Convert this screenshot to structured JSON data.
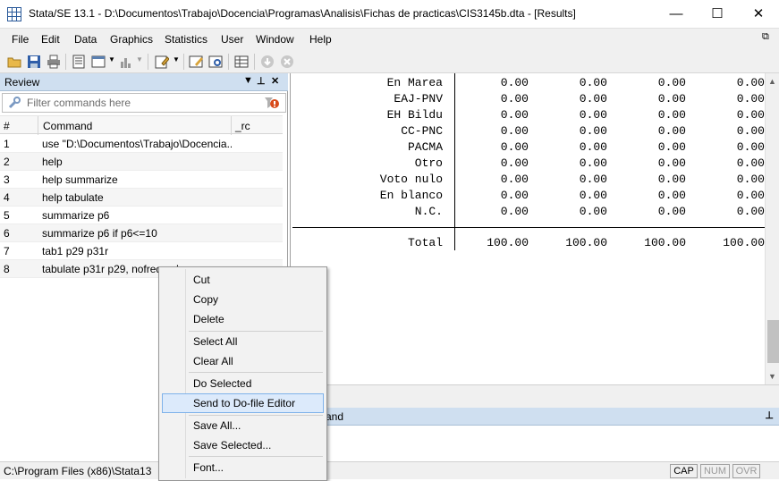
{
  "window": {
    "title": "Stata/SE 13.1 - D:\\Documentos\\Trabajo\\Docencia\\Programas\\Analisis\\Fichas de practicas\\CIS3145b.dta - [Results]",
    "minimize": "—",
    "maximize": "☐",
    "close": "✕"
  },
  "menu": [
    "File",
    "Edit",
    "Data",
    "Graphics",
    "Statistics",
    "User",
    "Window",
    "Help"
  ],
  "review": {
    "title": "Review",
    "filter_placeholder": "Filter commands here",
    "columns": {
      "num": "#",
      "command": "Command",
      "rc": "_rc"
    },
    "rows": [
      {
        "n": "1",
        "cmd": "use \"D:\\Documentos\\Trabajo\\Docencia..."
      },
      {
        "n": "2",
        "cmd": "help"
      },
      {
        "n": "3",
        "cmd": "help summarize"
      },
      {
        "n": "4",
        "cmd": "help tabulate"
      },
      {
        "n": "5",
        "cmd": "summarize p6"
      },
      {
        "n": "6",
        "cmd": "summarize p6 if p6<=10"
      },
      {
        "n": "7",
        "cmd": "tab1 p29 p31r"
      },
      {
        "n": "8",
        "cmd": "tabulate p31r p29, nofreq col"
      }
    ]
  },
  "results": {
    "rows": [
      {
        "label": "En Marea",
        "v": [
          "0.00",
          "0.00",
          "0.00",
          "0.00"
        ]
      },
      {
        "label": "EAJ-PNV",
        "v": [
          "0.00",
          "0.00",
          "0.00",
          "0.00"
        ]
      },
      {
        "label": "EH Bildu",
        "v": [
          "0.00",
          "0.00",
          "0.00",
          "0.00"
        ]
      },
      {
        "label": "CC-PNC",
        "v": [
          "0.00",
          "0.00",
          "0.00",
          "0.00"
        ]
      },
      {
        "label": "PACMA",
        "v": [
          "0.00",
          "0.00",
          "0.00",
          "0.00"
        ]
      },
      {
        "label": "Otro",
        "v": [
          "0.00",
          "0.00",
          "0.00",
          "0.00"
        ]
      },
      {
        "label": "Voto nulo",
        "v": [
          "0.00",
          "0.00",
          "0.00",
          "0.00"
        ]
      },
      {
        "label": "En blanco",
        "v": [
          "0.00",
          "0.00",
          "0.00",
          "0.00"
        ]
      },
      {
        "label": "N.C.",
        "v": [
          "0.00",
          "0.00",
          "0.00",
          "0.00"
        ]
      }
    ],
    "total": {
      "label": "Total",
      "v": [
        "100.00",
        "100.00",
        "100.00",
        "100.00"
      ]
    }
  },
  "command_panel": {
    "title": "and"
  },
  "status": {
    "path": "C:\\Program Files (x86)\\Stata13",
    "cap": "CAP",
    "num": "NUM",
    "ovr": "OVR"
  },
  "context_menu": {
    "items": [
      {
        "id": "cut",
        "label": "Cut"
      },
      {
        "id": "copy",
        "label": "Copy"
      },
      {
        "id": "delete",
        "label": "Delete"
      },
      {
        "id": "select-all",
        "label": "Select All"
      },
      {
        "id": "clear-all",
        "label": "Clear All"
      },
      {
        "id": "do-selected",
        "label": "Do Selected"
      },
      {
        "id": "send-to-dofile",
        "label": "Send to Do-file Editor"
      },
      {
        "id": "save-all",
        "label": "Save All..."
      },
      {
        "id": "save-selected",
        "label": "Save Selected..."
      },
      {
        "id": "font",
        "label": "Font..."
      }
    ]
  },
  "colors": {
    "panel_header": "#cfdff0",
    "highlight": "#dceafb",
    "toolbar": "#f0f0f0"
  }
}
